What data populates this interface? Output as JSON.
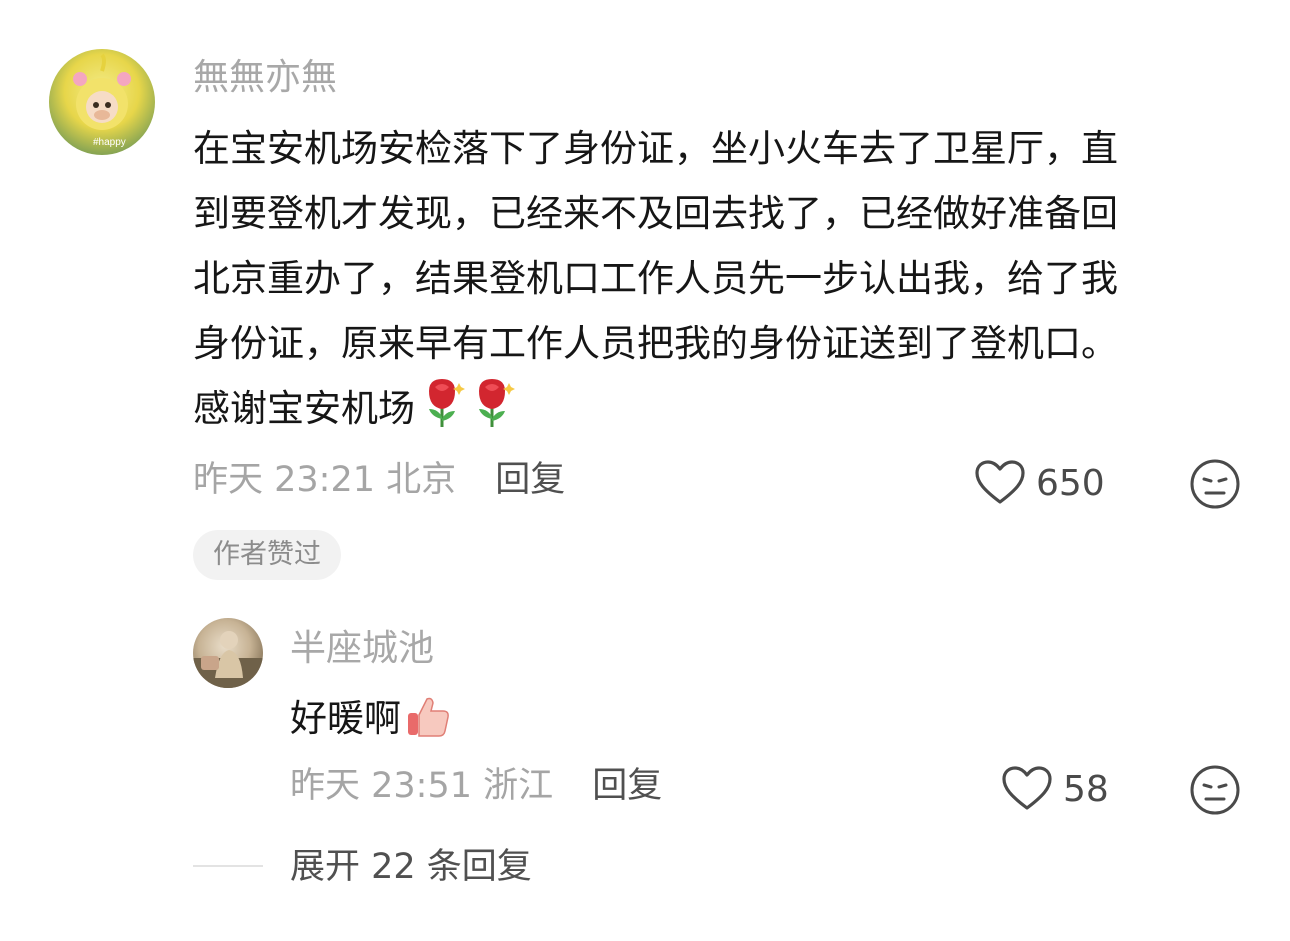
{
  "comment": {
    "username": "無無亦無",
    "avatar_icon": "teletubby-avatar",
    "text_lines": [
      "在宝安机场安检落下了身份证，坐小火车去了卫星厅，直",
      "到要登机才发现，已经来不及回去找了，已经做好准备回",
      "北京重办了，结果登机口工作人员先一步认出我，给了我",
      "身份证，原来早有工作人员把我的身份证送到了登机口。",
      "感谢宝安机场"
    ],
    "emojis": [
      "rose-icon",
      "rose-icon"
    ],
    "time": "昨天 23:21",
    "location": "北京",
    "reply_label": "回复",
    "like_count": "650",
    "badge": "作者赞过"
  },
  "reply": {
    "username": "半座城池",
    "avatar_icon": "photo-avatar",
    "text": "好暖啊",
    "emoji": "thumbs-up-icon",
    "time": "昨天 23:51",
    "location": "浙江",
    "reply_label": "回复",
    "like_count": "58"
  },
  "expand": {
    "label": "展开 22 条回复"
  },
  "colors": {
    "username": "#a8a8a8",
    "body_text": "#161616",
    "meta": "#a5a5a5",
    "reply_link": "#505050",
    "badge_bg": "#f2f2f2"
  }
}
